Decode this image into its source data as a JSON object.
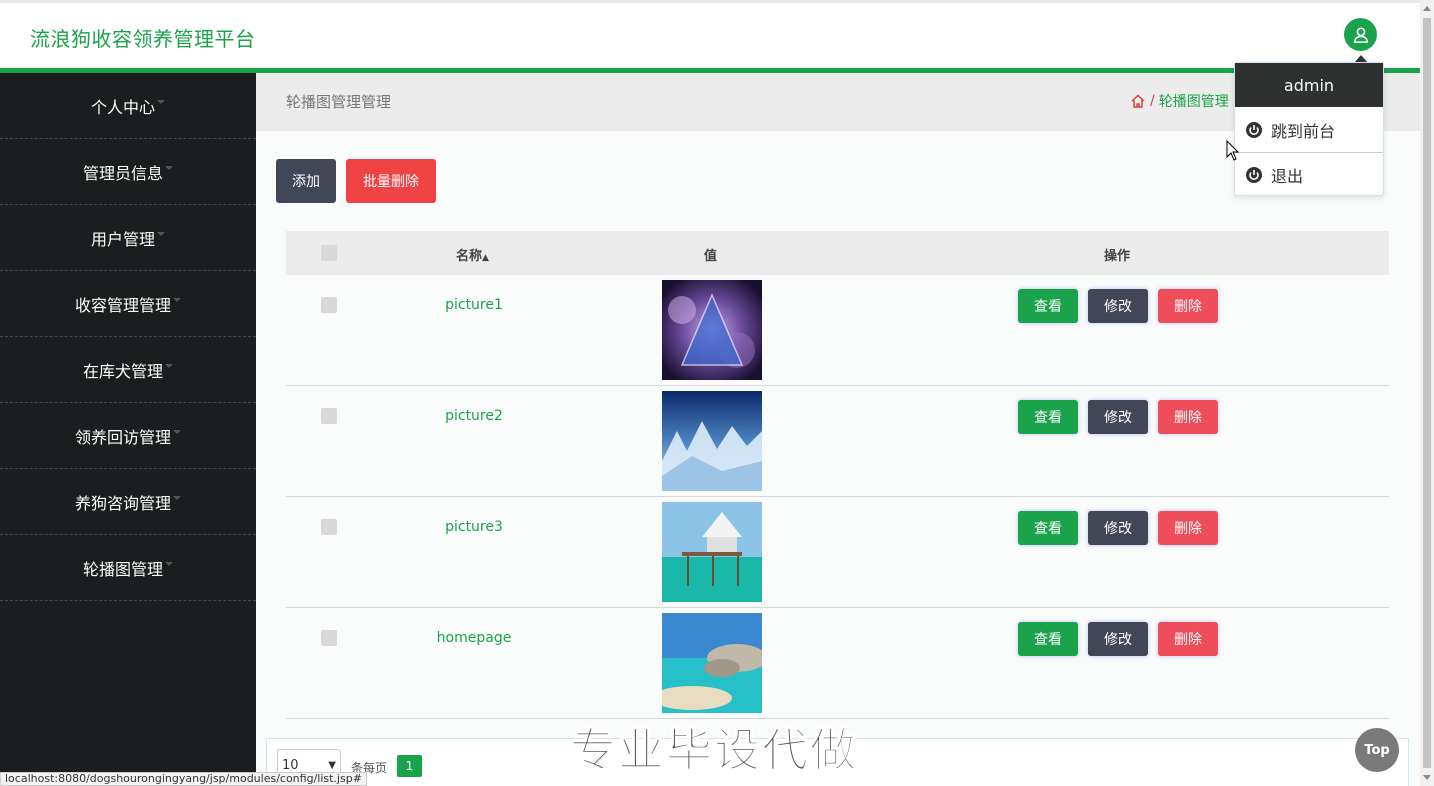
{
  "header": {
    "app_title": "流浪狗收容领养管理平台",
    "user_icon": "user-icon"
  },
  "sidebar": {
    "items": [
      {
        "label": "个人中心"
      },
      {
        "label": "管理员信息"
      },
      {
        "label": "用户管理"
      },
      {
        "label": "收容管理管理"
      },
      {
        "label": "在库犬管理"
      },
      {
        "label": "领养回访管理"
      },
      {
        "label": "养狗咨询管理"
      },
      {
        "label": "轮播图管理"
      }
    ]
  },
  "breadcrumb": {
    "title": "轮播图管理管理",
    "separator": "/",
    "current": "轮播图管理"
  },
  "toolbar": {
    "add_label": "添加",
    "batch_delete_label": "批量删除"
  },
  "table": {
    "columns": {
      "name": "名称",
      "value": "值",
      "actions": "操作"
    },
    "rows": [
      {
        "name": "picture1"
      },
      {
        "name": "picture2"
      },
      {
        "name": "picture3"
      },
      {
        "name": "homepage"
      }
    ],
    "actions": {
      "view": "查看",
      "edit": "修改",
      "delete": "删除"
    }
  },
  "pager": {
    "page_size": "10",
    "per_page_label": "条每页",
    "current_page": "1"
  },
  "dropdown": {
    "username": "admin",
    "goto_front": "跳到前台",
    "logout": "退出"
  },
  "watermark": "专业毕设代做",
  "top_button": "Top",
  "status_url": "localhost:8080/dogshourongingyang/jsp/modules/config/list.jsp#",
  "colors": {
    "brand_green": "#1aa34a",
    "danger_red": "#f04343",
    "dark_button": "#414757",
    "sidebar_bg": "#1b1e1e"
  }
}
